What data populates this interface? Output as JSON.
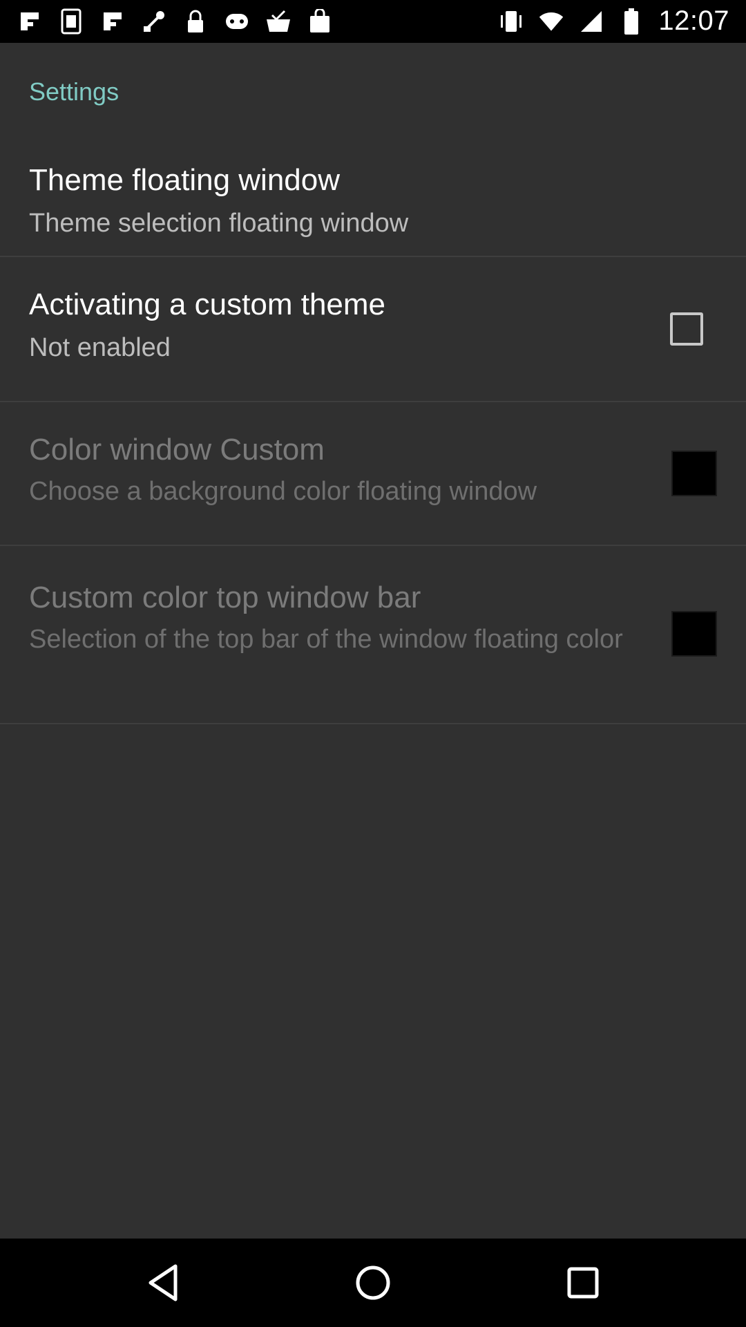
{
  "status_bar": {
    "time": "12:07",
    "left_icons": [
      "notification-icon",
      "sim-toolkit-icon",
      "notification-icon",
      "fake-gps-icon",
      "lock-icon",
      "game-icon",
      "task-done-icon",
      "bag-icon"
    ],
    "right_icons": [
      "vibrate-icon",
      "wifi-icon",
      "signal-icon",
      "battery-icon"
    ]
  },
  "screen": {
    "category_title": "Settings"
  },
  "prefs": [
    {
      "title": "Theme floating window",
      "summary": "Theme selection floating window",
      "widget": "none",
      "enabled": true
    },
    {
      "title": "Activating a custom theme",
      "summary": "Not enabled",
      "widget": "checkbox",
      "checked": false,
      "enabled": true
    },
    {
      "title": "Color window Custom",
      "summary": "Choose a background color floating window",
      "widget": "color-swatch",
      "color": "#000000",
      "enabled": false
    },
    {
      "title": "Custom color top window bar",
      "summary": "Selection of the top bar of the window floating color",
      "widget": "color-swatch",
      "color": "#000000",
      "enabled": false
    }
  ],
  "nav_bar": {
    "buttons": [
      "back-icon",
      "home-icon",
      "recents-icon"
    ]
  },
  "colors": {
    "background": "#303030",
    "accent": "#80cbc4",
    "status_bar": "#000000",
    "nav_bar": "#000000"
  }
}
